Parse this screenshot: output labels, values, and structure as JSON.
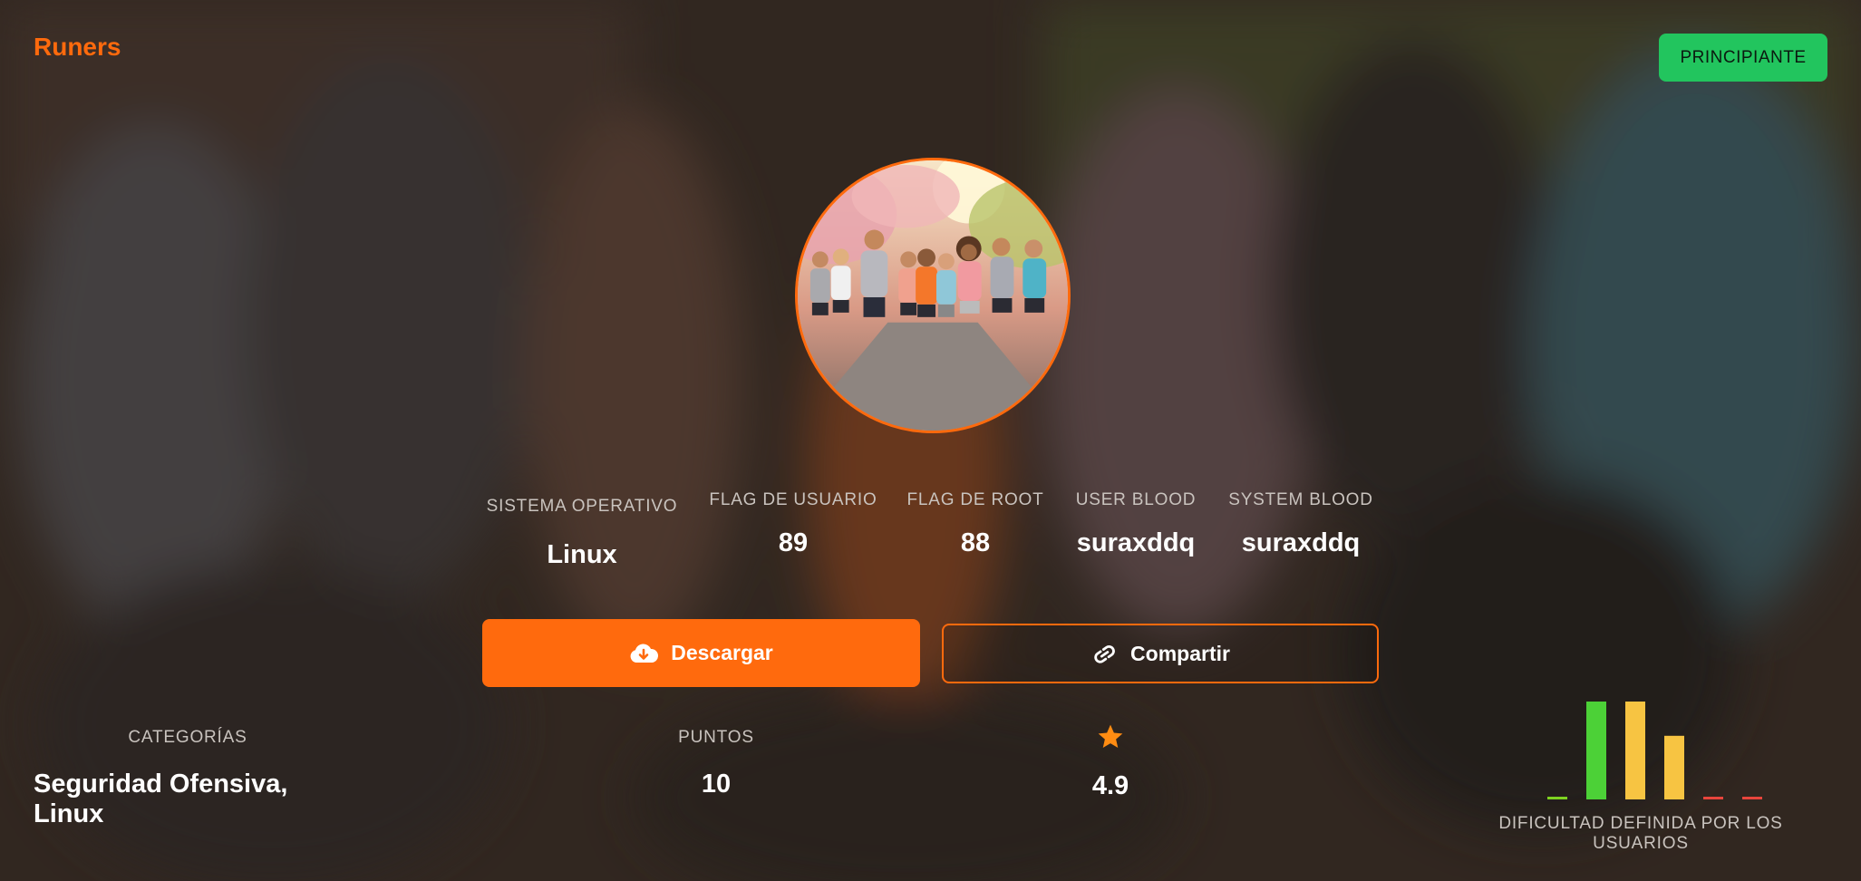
{
  "header": {
    "title": "Runers",
    "level_badge": "PRINCIPIANTE"
  },
  "avatar": {
    "icon": "runners-group-illustration"
  },
  "stats": [
    {
      "label": "SISTEMA OPERATIVO",
      "value": "Linux"
    },
    {
      "label": "FLAG DE USUARIO",
      "value": "89"
    },
    {
      "label": "FLAG DE ROOT",
      "value": "88"
    },
    {
      "label": "USER BLOOD",
      "value": "suraxddq"
    },
    {
      "label": "SYSTEM BLOOD",
      "value": "suraxddq"
    }
  ],
  "actions": {
    "download_label": "Descargar",
    "download_icon": "cloud-download-icon",
    "share_label": "Compartir",
    "share_icon": "link-icon"
  },
  "details": {
    "categories_label": "CATEGORÍAS",
    "categories_value": "Seguridad Ofensiva, Linux",
    "points_label": "PUNTOS",
    "points_value": "10",
    "rating_icon": "star-icon",
    "rating_value": "4.9"
  },
  "difficulty": {
    "caption": "DIFICULTAD DEFINIDA POR LOS USUARIOS",
    "votes": [
      0.02,
      1.0,
      1.0,
      0.65,
      0.02,
      0.02
    ],
    "colors": [
      "#7ed321",
      "#4cd137",
      "#f7c442",
      "#f7c442",
      "#e8453c",
      "#e8453c"
    ]
  },
  "theme": {
    "accent": "#ff6a0d",
    "badge": "#22c55e"
  }
}
